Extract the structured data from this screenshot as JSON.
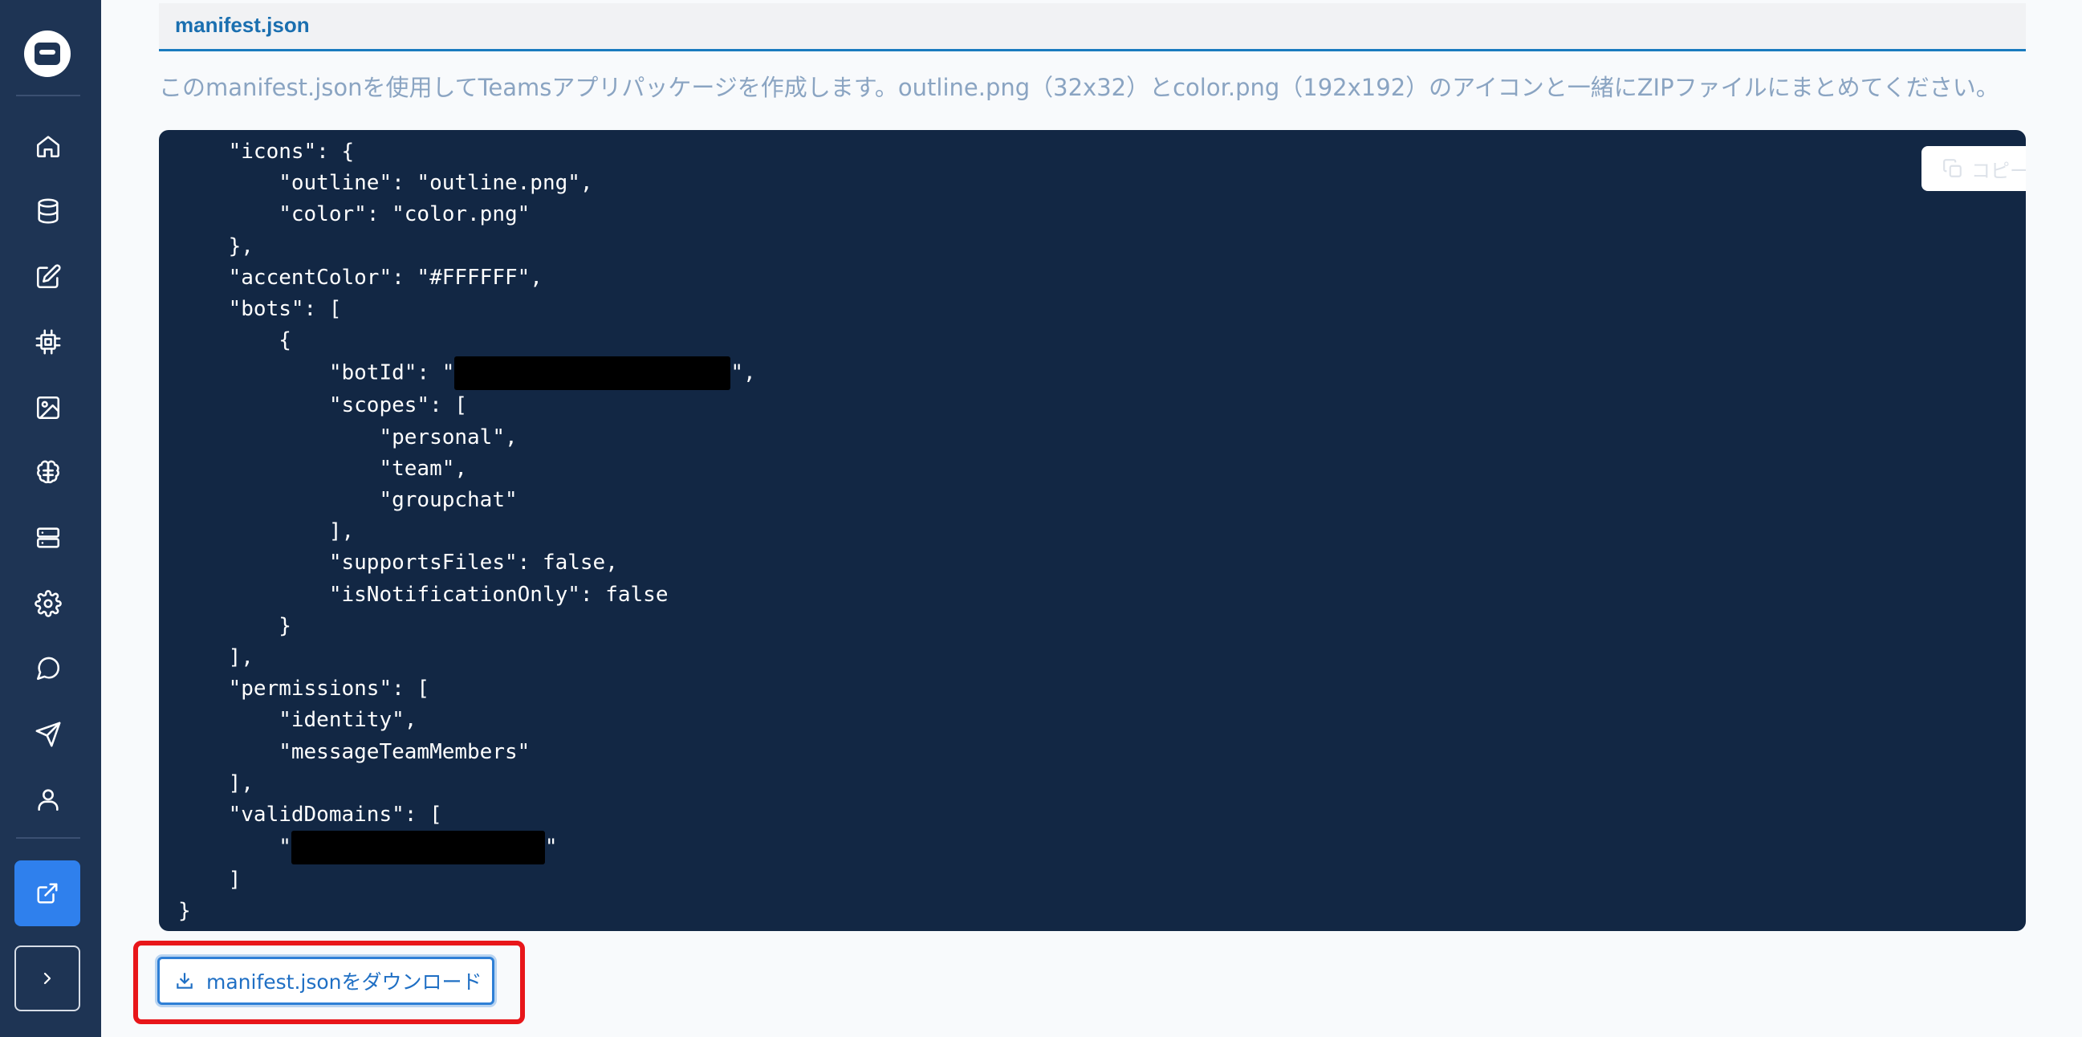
{
  "section": {
    "title": "manifest.json",
    "description": "このmanifest.jsonを使用してTeamsアプリパッケージを作成します。outline.png（32x32）とcolor.png（192x192）のアイコンと一緒にZIPファイルにまとめてください。"
  },
  "code": {
    "lines": [
      "    \"icons\": {",
      "        \"outline\": \"outline.png\",",
      "        \"color\": \"color.png\"",
      "    },",
      "    \"accentColor\": \"#FFFFFF\",",
      "    \"bots\": [",
      "        {",
      "            \"botId\": \"",
      "            \"scopes\": [",
      "                \"personal\",",
      "                \"team\",",
      "                \"groupchat\"",
      "            ],",
      "            \"supportsFiles\": false,",
      "            \"isNotificationOnly\": false",
      "        }",
      "    ],",
      "    \"permissions\": [",
      "        \"identity\",",
      "        \"messageTeamMembers\"",
      "    ],",
      "    \"validDomains\": [",
      "        \"",
      "    ]",
      "}"
    ],
    "bot_id_suffix": "\",",
    "domain_suffix": "\""
  },
  "copy_button": {
    "label": "コピーする",
    "icon": "copy-icon"
  },
  "download_button": {
    "label": "manifest.jsonをダウンロード",
    "icon": "download-icon"
  },
  "sidebar": {
    "items": [
      {
        "icon": "home-icon"
      },
      {
        "icon": "database-icon"
      },
      {
        "icon": "edit-icon"
      },
      {
        "icon": "chip-icon"
      },
      {
        "icon": "image-icon"
      },
      {
        "icon": "brain-icon"
      },
      {
        "icon": "server-icon"
      },
      {
        "icon": "gear-icon"
      },
      {
        "icon": "chat-icon"
      },
      {
        "icon": "send-icon"
      },
      {
        "icon": "user-icon"
      }
    ],
    "active_icon": "external-link-icon",
    "expand_icon": "chevron-right-icon"
  },
  "colors": {
    "sidebar": "#1e3454",
    "code_bg": "#122744",
    "accent": "#2f80ed",
    "highlight": "#e8161a"
  }
}
